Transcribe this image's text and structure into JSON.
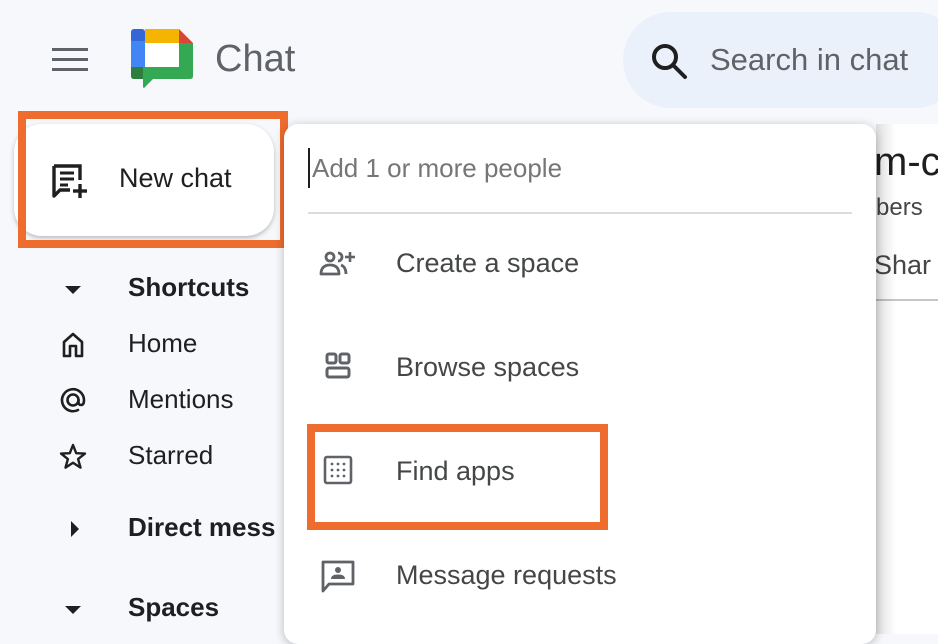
{
  "app": {
    "title": "Chat",
    "brand_colors": {
      "blue": "#4285f4",
      "dark_blue": "#3367d6",
      "yellow": "#f4b400",
      "red": "#db4437",
      "green": "#0f9d58",
      "dark_green": "#2d7d3f"
    }
  },
  "header": {
    "menu_icon": "hamburger-menu-icon",
    "search": {
      "placeholder": "Search in chat",
      "value": "",
      "icon": "search-icon"
    }
  },
  "new_chat": {
    "label": "New chat",
    "icon": "new-chat-icon"
  },
  "sidebar": {
    "sections": [
      {
        "label": "Shortcuts",
        "expanded": true,
        "icon": "caret-down-icon"
      },
      {
        "label": "Direct messages",
        "display_label": "Direct mess",
        "expanded": false,
        "icon": "caret-right-icon"
      },
      {
        "label": "Spaces",
        "expanded": true,
        "icon": "caret-down-icon"
      }
    ],
    "shortcuts": [
      {
        "label": "Home",
        "icon": "home-icon"
      },
      {
        "label": "Mentions",
        "icon": "at-icon"
      },
      {
        "label": "Starred",
        "icon": "star-icon"
      }
    ]
  },
  "dropdown": {
    "people_input": {
      "placeholder": "Add 1 or more people",
      "value": ""
    },
    "items": [
      {
        "label": "Create a space",
        "icon": "group-add-icon"
      },
      {
        "label": "Browse spaces",
        "icon": "browse-spaces-icon"
      },
      {
        "label": "Find apps",
        "icon": "apps-grid-icon",
        "highlighted": true
      },
      {
        "label": "Message requests",
        "icon": "message-request-icon"
      }
    ]
  },
  "background_content": {
    "title_fragment": "m-c",
    "members_fragment": "bers",
    "share_fragment": "Shar"
  },
  "annotations": {
    "highlight_color": "#ee6c2d",
    "highlighted": [
      "New chat",
      "Find apps"
    ]
  }
}
